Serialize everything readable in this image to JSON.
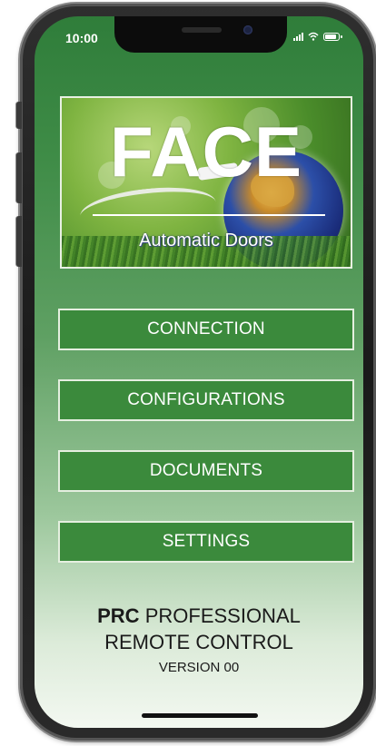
{
  "status_bar": {
    "time": "10:00",
    "icons": [
      "signal-icon",
      "wifi-icon",
      "battery-icon"
    ]
  },
  "banner": {
    "title": "FACE",
    "subtitle": "Automatic Doors"
  },
  "menu": {
    "items": [
      {
        "label": "CONNECTION"
      },
      {
        "label": "CONFIGURATIONS"
      },
      {
        "label": "DOCUMENTS"
      },
      {
        "label": "SETTINGS"
      }
    ]
  },
  "footer": {
    "brand": "PRC",
    "line1_rest": "PROFESSIONAL",
    "line2": "REMOTE CONTROL",
    "version": "VERSION 00"
  },
  "colors": {
    "button_bg": "#3b8a3c",
    "gradient_top": "#2f7d3a",
    "gradient_bottom": "#f3f8f1"
  }
}
